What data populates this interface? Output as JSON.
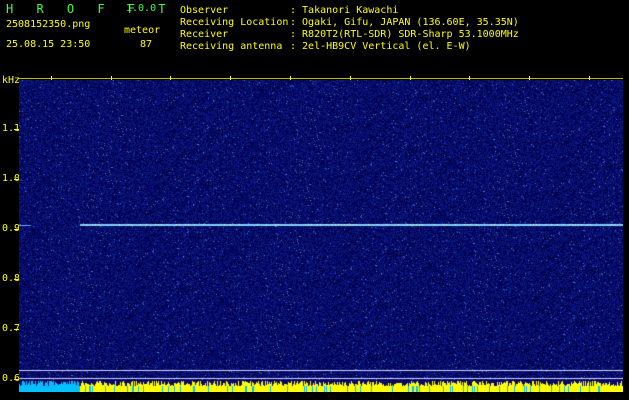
{
  "header": {
    "app_name": "H R O F F T",
    "version": "1.0.0",
    "filename": "2508152350.png",
    "datetime": "25.08.15 23:50",
    "mode_label": "meteor",
    "count": "87",
    "info_labels": [
      "Observer",
      "Receiving Location",
      "Receiver",
      "Receiving antenna"
    ],
    "info_values": [
      ": Takanori Kawachi",
      ": Ogaki, Gifu, JAPAN (136.60E, 35.35N)",
      ": R820T2(RTL-SDR) SDR-Sharp 53.1000MHz",
      ": 2el-HB9CV Vertical (el. E-W)"
    ]
  },
  "axis": {
    "y_unit": "kHz",
    "x_ticks": [
      "2351",
      "2352",
      "2353",
      "2354",
      "2355",
      "2356",
      "2357",
      "2358",
      "2359",
      "0000"
    ],
    "y_ticks": [
      "1.1",
      "1.0",
      "0.9",
      "0.8",
      "0.7",
      "0.6"
    ]
  },
  "colors": {
    "text": "#ffff00",
    "title": "#40ff40",
    "background": "#000000",
    "spectrogram_bg": "#0a0a66",
    "signal_line": "#7fd0ff",
    "bottom_bar_primary": "#ffff00",
    "bottom_bar_secondary": "#00c0ff"
  }
}
